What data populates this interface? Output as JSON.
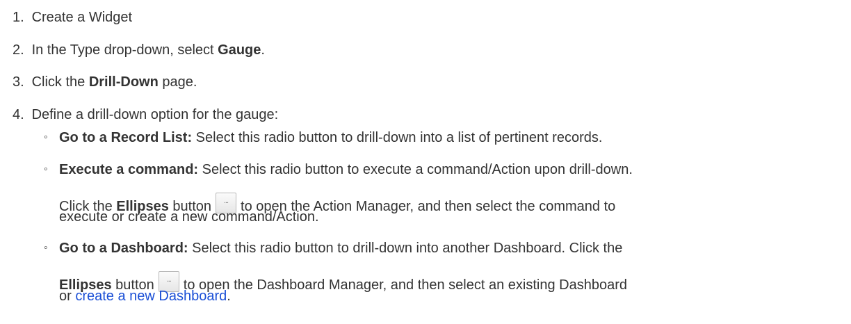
{
  "steps": [
    {
      "num": "1.",
      "text": "Create a Widget"
    },
    {
      "num": "2.",
      "pre": "In the Type drop-down, select ",
      "bold": "Gauge",
      "post": "."
    },
    {
      "num": "3.",
      "pre": "Click the ",
      "bold": "Drill-Down",
      "post": " page."
    },
    {
      "num": "4.",
      "text": "Define a drill-down option for the gauge:"
    }
  ],
  "options": {
    "bullet_glyph": "◦",
    "record_list": {
      "title": "Go to a Record List:",
      "text": " Select this radio button to drill-down into a list of pertinent records."
    },
    "command": {
      "title": "Execute a command:",
      "text": " Select this radio button to execute a command/Action upon drill-down.",
      "detail_pre": "Click the ",
      "detail_bold": "Ellipses",
      "detail_mid": " button",
      "detail_post": "to open the Action Manager, and then select the command to",
      "detail_line2": "execute or create a new command/Action."
    },
    "dashboard": {
      "title": "Go to a Dashboard:",
      "text": " Select this radio button to drill-down into another Dashboard. Click the",
      "line2_bold": "Ellipses",
      "line2_mid": " button",
      "line2_post": "to open the Dashboard Manager, and then select an existing Dashboard",
      "line3_pre": "or ",
      "link": "create a new Dashboard",
      "line3_post": "."
    }
  },
  "ellipses_button_glyph": "..."
}
